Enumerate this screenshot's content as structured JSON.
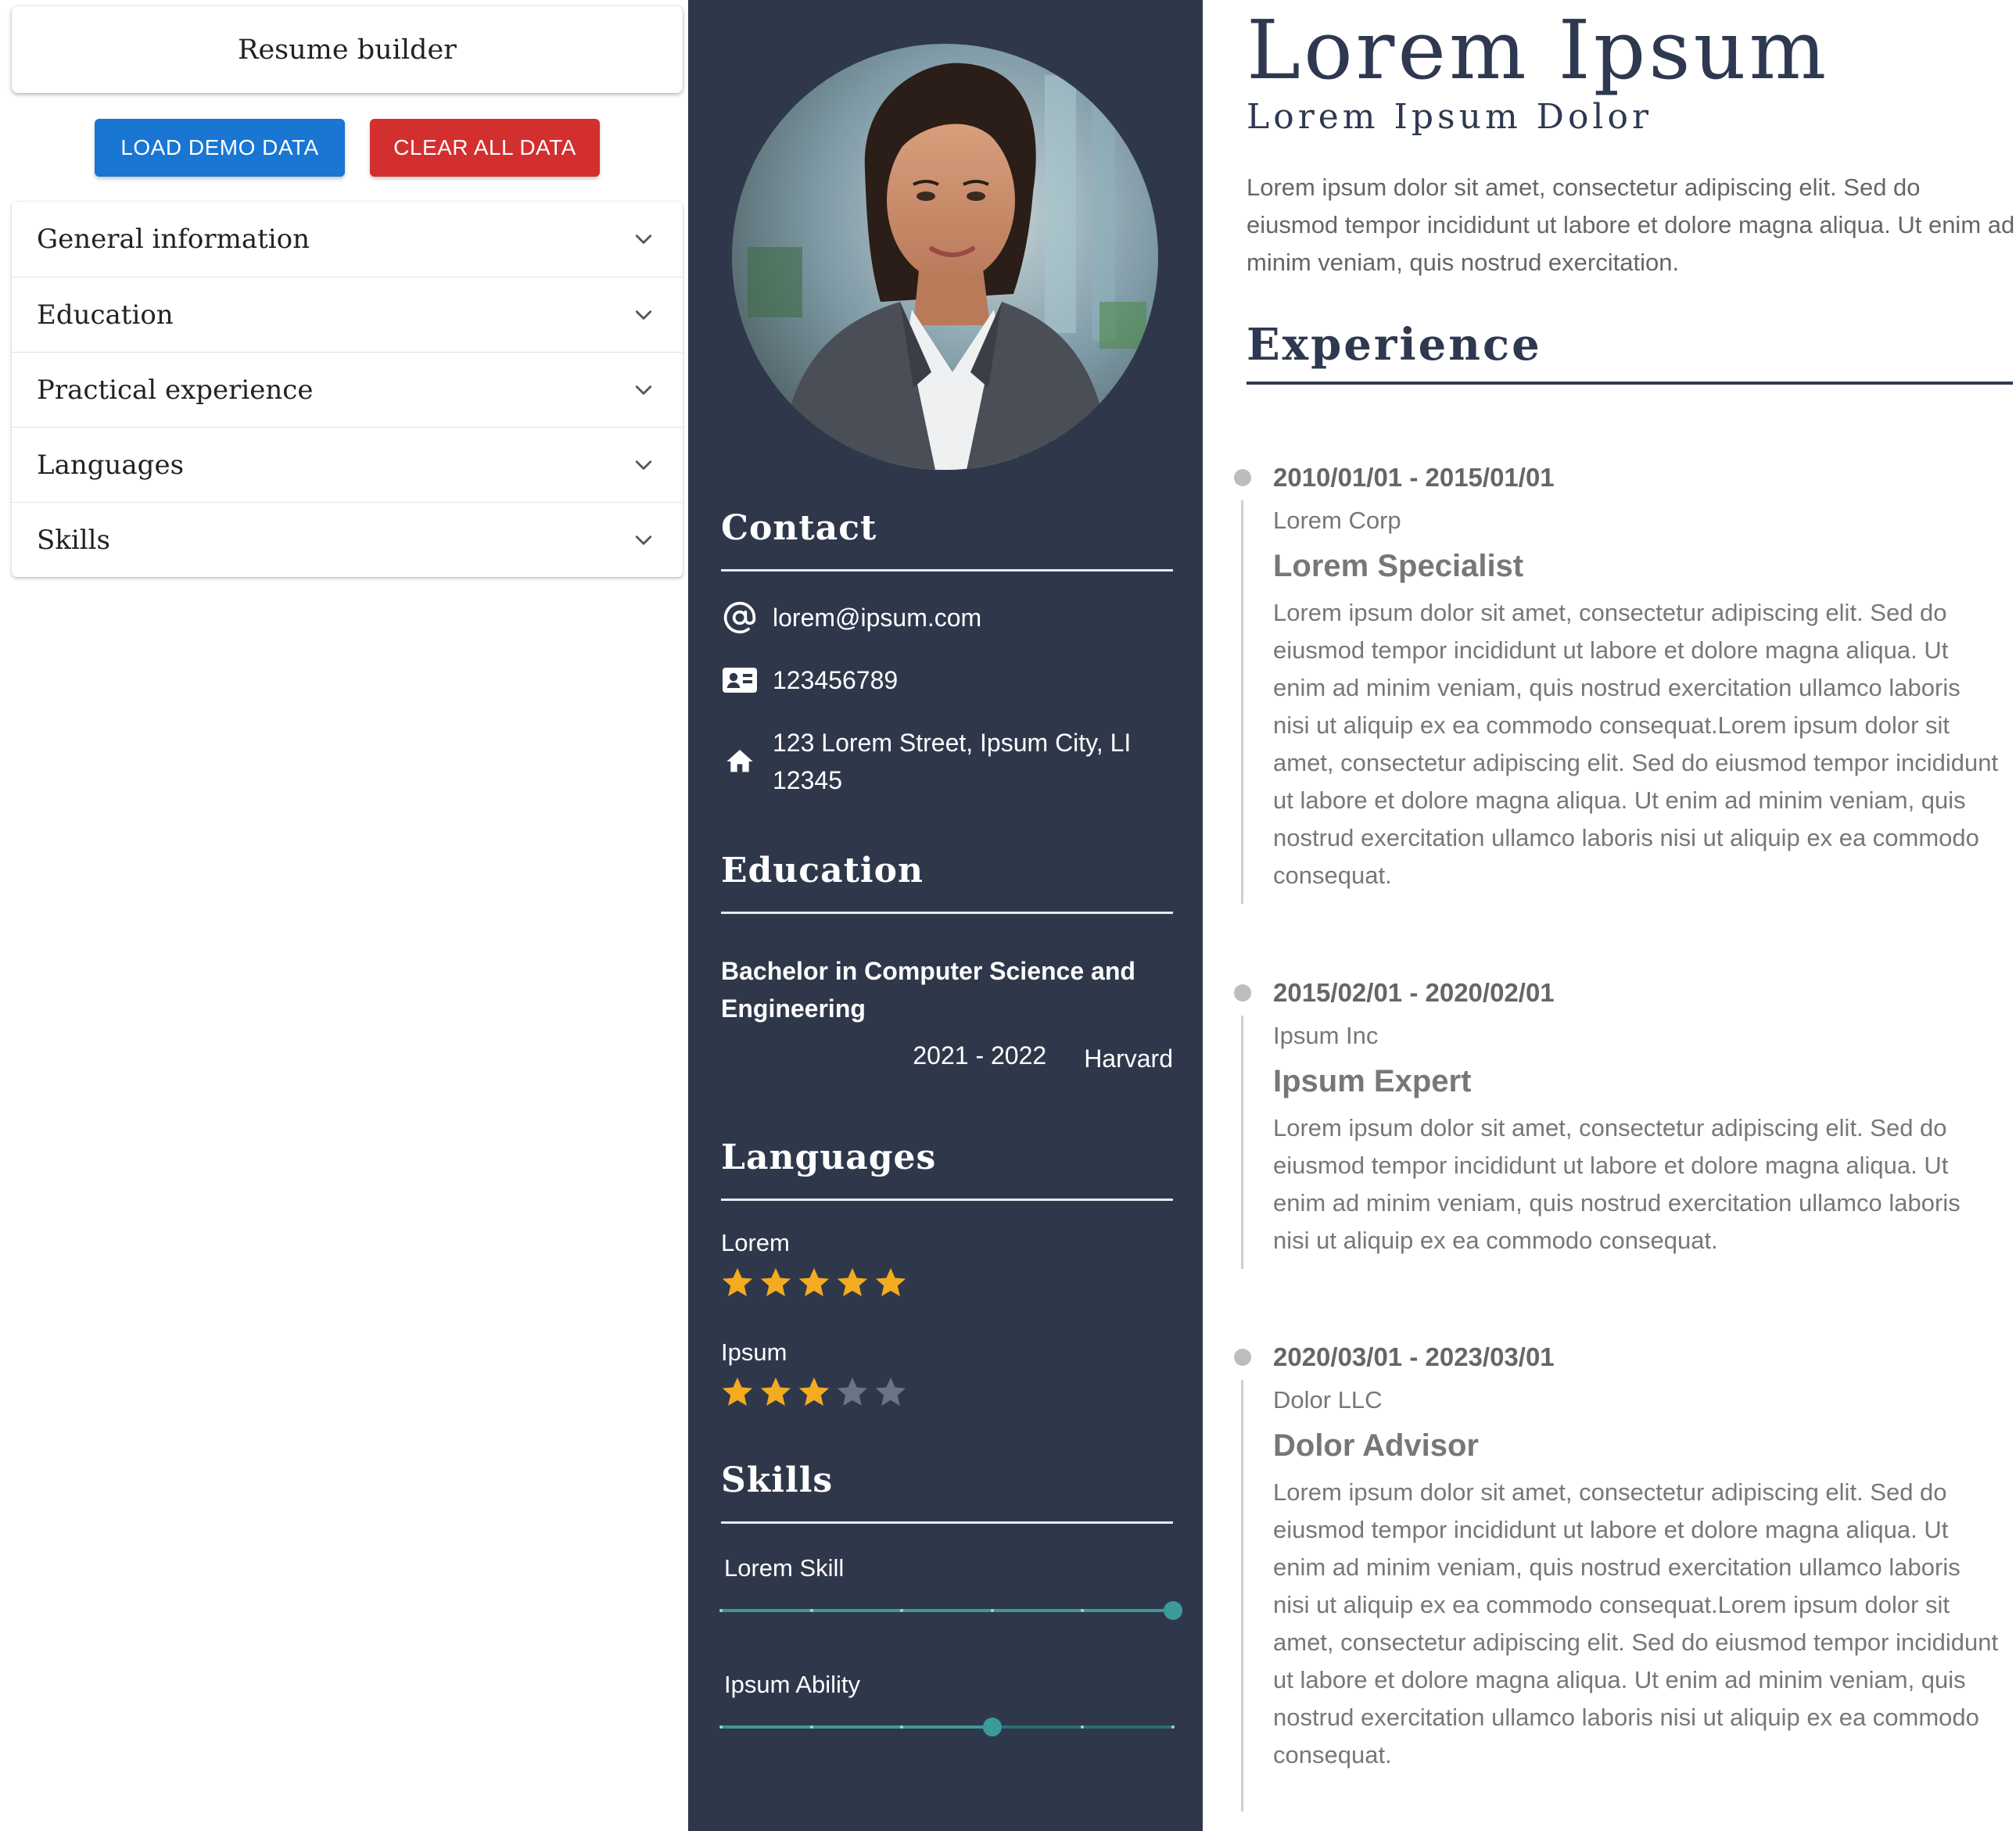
{
  "editor": {
    "title": "Resume builder",
    "load_demo_label": "LOAD DEMO DATA",
    "clear_all_label": "CLEAR ALL DATA",
    "sections": [
      {
        "label": "General information",
        "icon": "chevron-down-icon"
      },
      {
        "label": "Education",
        "icon": "chevron-down-icon"
      },
      {
        "label": "Practical experience",
        "icon": "chevron-down-icon"
      },
      {
        "label": "Languages",
        "icon": "chevron-down-icon"
      },
      {
        "label": "Skills",
        "icon": "chevron-down-icon"
      }
    ],
    "colors": {
      "load_button": "#1976d2",
      "clear_button": "#d32f2f"
    }
  },
  "sidebar": {
    "background": "#2f384b",
    "photo_alt": "profile-photo",
    "contact": {
      "heading": "Contact",
      "email": "lorem@ipsum.com",
      "phone": "123456789",
      "address": "123 Lorem Street, Ipsum City, LI 12345"
    },
    "education": {
      "heading": "Education",
      "degree": "Bachelor in Computer Science and Engineering",
      "years": "2021 - 2022",
      "school": "Harvard"
    },
    "languages": {
      "heading": "Languages",
      "items": [
        {
          "name": "Lorem",
          "rating": 5,
          "max": 5
        },
        {
          "name": "Ipsum",
          "rating": 3,
          "max": 5
        }
      ],
      "star_color": "#f4ab1f"
    },
    "skills": {
      "heading": "Skills",
      "items": [
        {
          "name": "Lorem Skill",
          "level": 5,
          "max": 5
        },
        {
          "name": "Ipsum Ability",
          "level": 3,
          "max": 5
        }
      ],
      "slider_color": "#3a9b98"
    }
  },
  "resume": {
    "name": "Lorem Ipsum",
    "title": "Lorem Ipsum Dolor",
    "summary": "Lorem ipsum dolor sit amet, consectetur adipiscing elit. Sed do eiusmod tempor incididunt ut labore et dolore magna aliqua. Ut enim ad minim veniam, quis nostrud exercitation.",
    "experience_heading": "Experience",
    "jobs": [
      {
        "dates": "2010/01/01 - 2015/01/01",
        "company": "Lorem Corp",
        "role": "Lorem Specialist",
        "description": "Lorem ipsum dolor sit amet, consectetur adipiscing elit. Sed do eiusmod tempor incididunt ut labore et dolore magna aliqua. Ut enim ad minim veniam, quis nostrud exercitation ullamco laboris nisi ut aliquip ex ea commodo consequat.Lorem ipsum dolor sit amet, consectetur adipiscing elit. Sed do eiusmod tempor incididunt ut labore et dolore magna aliqua. Ut enim ad minim veniam, quis nostrud exercitation ullamco laboris nisi ut aliquip ex ea commodo consequat."
      },
      {
        "dates": "2015/02/01 - 2020/02/01",
        "company": "Ipsum Inc",
        "role": "Ipsum Expert",
        "description": "Lorem ipsum dolor sit amet, consectetur adipiscing elit. Sed do eiusmod tempor incididunt ut labore et dolore magna aliqua. Ut enim ad minim veniam, quis nostrud exercitation ullamco laboris nisi ut aliquip ex ea commodo consequat."
      },
      {
        "dates": "2020/03/01 - 2023/03/01",
        "company": "Dolor LLC",
        "role": "Dolor Advisor",
        "description": "Lorem ipsum dolor sit amet, consectetur adipiscing elit. Sed do eiusmod tempor incididunt ut labore et dolore magna aliqua. Ut enim ad minim veniam, quis nostrud exercitation ullamco laboris nisi ut aliquip ex ea commodo consequat.Lorem ipsum dolor sit amet, consectetur adipiscing elit. Sed do eiusmod tempor incididunt ut labore et dolore magna aliqua. Ut enim ad minim veniam, quis nostrud exercitation ullamco laboris nisi ut aliquip ex ea commodo consequat."
      }
    ]
  }
}
